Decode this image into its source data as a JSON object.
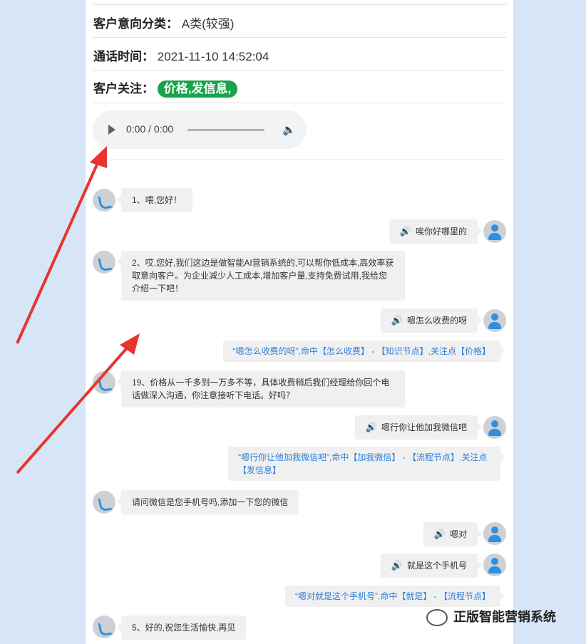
{
  "info": {
    "category_label": "客户意向分类：",
    "category_value": "A类(较强)",
    "call_time_label": "通话时间：",
    "call_time_value": "2021-11-10 14:52:04",
    "focus_label": "客户关注：",
    "focus_tag": "价格,发信息,"
  },
  "audio": {
    "time": "0:00 / 0:00"
  },
  "messages": {
    "m1": "1、喂,您好！",
    "m2": "唉你好哪里的",
    "m3": "2、哎,您好,我们这边是做智能AI营销系统的,可以帮你低成本,高效率获取意向客户。为企业减少人工成本,增加客户量,支持免费试用,我给您介绍一下吧！",
    "m4": "嗯怎么收费的呀",
    "n1": "“嗯怎么收费的呀”,命中【怎么收费】 - 【知识节点】,关注点【价格】",
    "m5": "19、价格从一千多到一万多不等，具体收费稍后我们经理给你回个电话做深入沟通，你注意接听下电话。好吗？",
    "m6": "嗯行你让他加我微信吧",
    "n2": "“嗯行你让他加我微信吧”,命中【加我微信】 - 【流程节点】,关注点【发信息】",
    "m7": "请问微信是您手机号吗,添加一下您的微信",
    "m8": "嗯对",
    "m9": "就是这个手机号",
    "n3": "“嗯对就是这个手机号”,命中【就是】 - 【流程节点】",
    "m10": "5、好的,祝您生活愉快,再见"
  },
  "watermark": "正版智能营销系统",
  "colors": {
    "accent_green": "#19a34a",
    "link_blue": "#2b7fd8",
    "arrow_red": "#e8342f",
    "page_bg": "#d6e6f7"
  }
}
